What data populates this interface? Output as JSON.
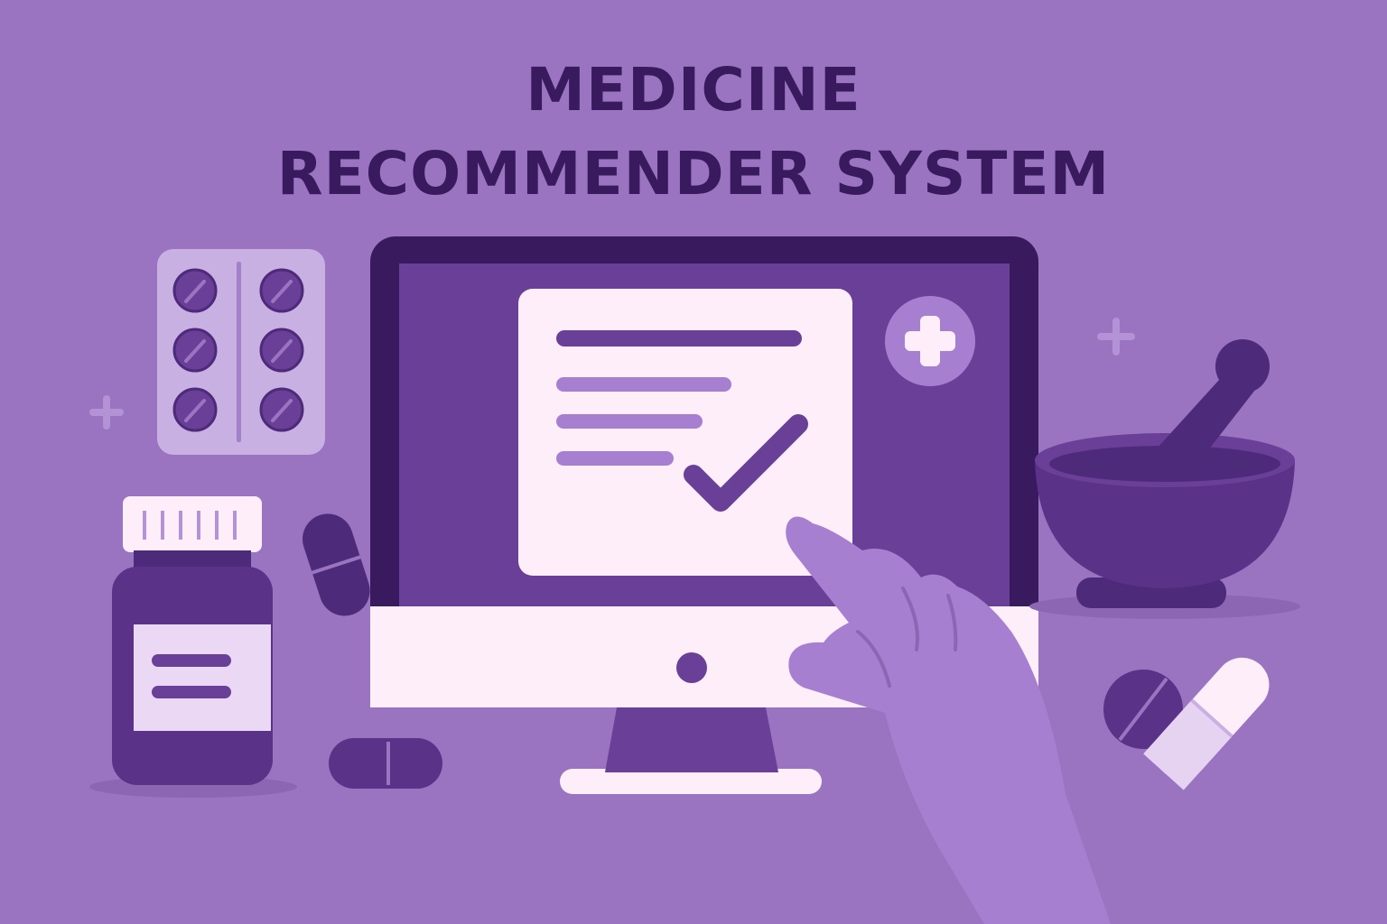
{
  "title": {
    "line1": "MEDICINE",
    "line2": "RECOMMENDER SYSTEM"
  },
  "colors": {
    "background": "#9a74c0",
    "dark": "#3a1a5e",
    "mid": "#6a3f98",
    "light": "#fdeefa",
    "accent": "#a77fd0"
  },
  "icons": [
    "blister-pack-icon",
    "pill-bottle-icon",
    "capsule-icon",
    "monitor-icon",
    "checklist-card-icon",
    "medical-cross-icon",
    "pointing-hand-icon",
    "mortar-pestle-icon",
    "tablet-pill-icon",
    "sparkle-plus-icon"
  ]
}
